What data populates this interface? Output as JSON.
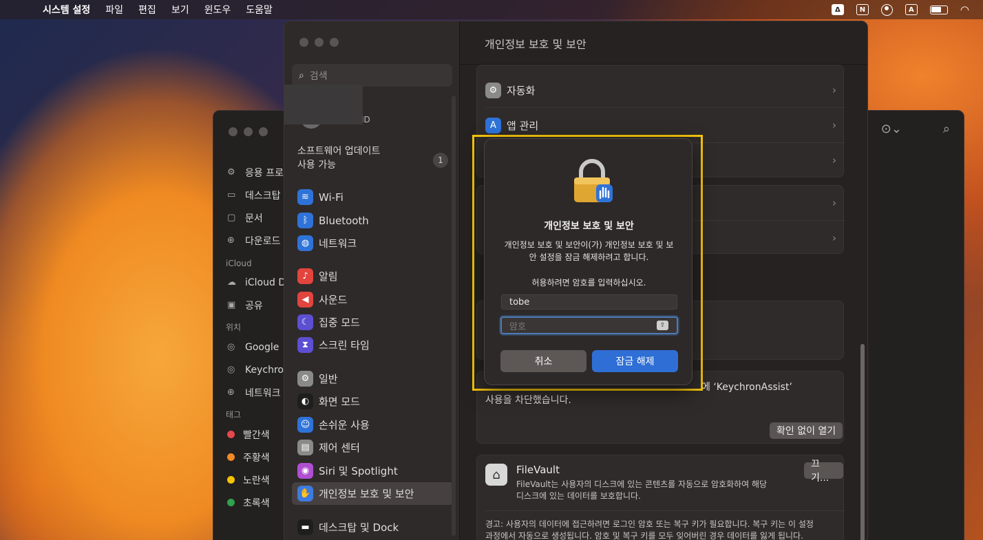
{
  "menubar": {
    "app": "시스템 설정",
    "items": [
      "파일",
      "편집",
      "보기",
      "윈도우",
      "도움말"
    ],
    "status_icons": [
      "Δ",
      "N",
      "A"
    ]
  },
  "finder": {
    "sidebar": {
      "items_top": [
        {
          "label": "응용 프로",
          "icon": "applications-icon",
          "glyph": "⚙"
        },
        {
          "label": "데스크탑",
          "icon": "desktop-icon",
          "glyph": "▭"
        },
        {
          "label": "문서",
          "icon": "document-icon",
          "glyph": "📄"
        },
        {
          "label": "다운로드",
          "icon": "download-icon",
          "glyph": "⊕"
        }
      ],
      "icloud_header": "iCloud",
      "icloud_items": [
        {
          "label": "iCloud D",
          "icon": "cloud-icon",
          "glyph": "☁"
        },
        {
          "label": "공유",
          "icon": "shared-folder-icon",
          "glyph": "▣"
        }
      ],
      "location_header": "위치",
      "location_items": [
        {
          "label": "Google",
          "icon": "drive-icon",
          "glyph": "◎"
        },
        {
          "label": "Keychro",
          "icon": "drive-icon",
          "glyph": "◎"
        },
        {
          "label": "네트워크",
          "icon": "network-icon",
          "glyph": "⊕"
        }
      ],
      "tags_header": "태그",
      "tags": [
        {
          "label": "빨간색",
          "color": "#e5484d"
        },
        {
          "label": "주황색",
          "color": "#f08a24"
        },
        {
          "label": "노란색",
          "color": "#f5c400"
        },
        {
          "label": "초록색",
          "color": "#30a14e"
        }
      ]
    }
  },
  "settings": {
    "search_placeholder": "검색",
    "apple_id_tail": "ID",
    "update": {
      "line1": "소프트웨어 업데이트",
      "line2": "사용 가능",
      "count": "1"
    },
    "sidebar": [
      {
        "label": "Wi-Fi",
        "color": "#2f73d9",
        "glyph": "≋",
        "icon": "wifi-icon"
      },
      {
        "label": "Bluetooth",
        "color": "#2f73d9",
        "glyph": "ᛒ",
        "icon": "bluetooth-icon"
      },
      {
        "label": "네트워크",
        "color": "#2f73d9",
        "glyph": "◍",
        "icon": "globe-icon"
      },
      {
        "label": "알림",
        "color": "#e2443e",
        "glyph": "🔔",
        "icon": "bell-icon"
      },
      {
        "label": "사운드",
        "color": "#e2443e",
        "glyph": "🔊",
        "icon": "speaker-icon"
      },
      {
        "label": "집중 모드",
        "color": "#5d4fd1",
        "glyph": "☾",
        "icon": "moon-icon"
      },
      {
        "label": "스크린 타임",
        "color": "#5d4fd1",
        "glyph": "⧗",
        "icon": "hourglass-icon"
      },
      {
        "label": "일반",
        "color": "#8a8a8a",
        "glyph": "⚙",
        "icon": "gear-icon"
      },
      {
        "label": "화면 모드",
        "color": "#1e1e1e",
        "glyph": "◐",
        "icon": "appearance-icon"
      },
      {
        "label": "손쉬운 사용",
        "color": "#2f73d9",
        "glyph": "♿",
        "icon": "accessibility-icon"
      },
      {
        "label": "제어 센터",
        "color": "#8a8a8a",
        "glyph": "▤",
        "icon": "control-center-icon"
      },
      {
        "label": "Siri 및 Spotlight",
        "color": "#b04fd1",
        "glyph": "◉",
        "icon": "siri-icon"
      },
      {
        "label": "개인정보 보호 및 보안",
        "color": "#3d7be0",
        "glyph": "✋",
        "icon": "hand-icon"
      },
      {
        "label": "데스크탑 및 Dock",
        "color": "#1e1e1e",
        "glyph": "▬",
        "icon": "dock-icon"
      }
    ],
    "main": {
      "title": "개인정보 보호 및 보안",
      "rows": [
        {
          "label": "자동화",
          "icon": "gears-icon",
          "glyph": "⚙",
          "color": "#8a8a8a"
        },
        {
          "label": "앱 관리",
          "icon": "app-store-icon",
          "glyph": "A",
          "color": "#2f73d9"
        }
      ],
      "blocked_text_tail": "에 ‘KeychronAssist’",
      "blocked_text_line2": "사용을 차단했습니다.",
      "open_anyway": "확인 없이 열기",
      "filevault": {
        "title": "FileVault",
        "desc1": "FileVault는 사용자의 디스크에 있는 콘텐츠를 자동으로 암호화하여 해당",
        "desc2": "디스크에 있는 데이터를 보호합니다.",
        "button": "끄기...",
        "warning1": "경고: 사용자의 데이터에 접근하려면 로그인 암호 또는 복구 키가 필요합니다. 복구 키는 이 설정",
        "warning2": "과정에서 자동으로 생성됩니다. 암호 및 복구 키를 모두 잊어버린 경우 데이터를 잃게 됩니다."
      }
    }
  },
  "dialog": {
    "title": "개인정보 보호 및 보안",
    "message_line1": "개인정보 보호 및 보안이(가) 개인정보 보호 및 보",
    "message_line2": "안 설정을 잠금 해제하려고 합니다.",
    "prompt": "허용하려면 암호를 입력하십시오.",
    "username": "tobe",
    "password_placeholder": "암호",
    "cancel": "취소",
    "unlock": "잠금 해제"
  }
}
